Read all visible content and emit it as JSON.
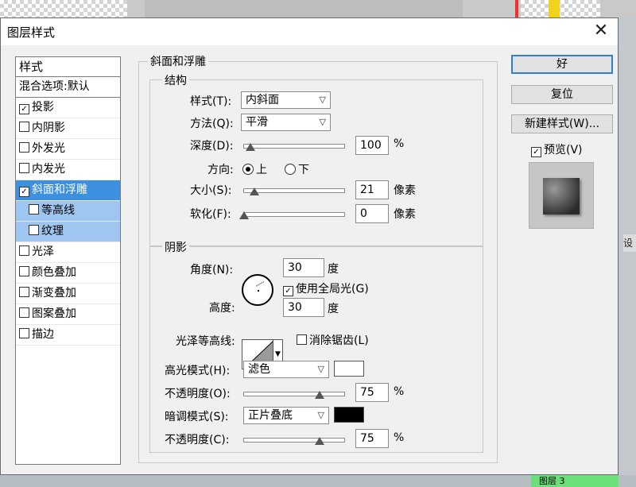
{
  "window": {
    "title": "图层样式",
    "close_glyph": "✕"
  },
  "style_list": {
    "header": "样式",
    "blend": "混合选项:默认",
    "items": [
      {
        "label": "投影",
        "checked": true
      },
      {
        "label": "内阴影",
        "checked": false
      },
      {
        "label": "外发光",
        "checked": false
      },
      {
        "label": "内发光",
        "checked": false
      },
      {
        "label": "斜面和浮雕",
        "checked": true,
        "selected": true
      },
      {
        "label": "等高线",
        "checked": false,
        "sub": true
      },
      {
        "label": "纹理",
        "checked": false,
        "sub": true
      },
      {
        "label": "光泽",
        "checked": false
      },
      {
        "label": "颜色叠加",
        "checked": false
      },
      {
        "label": "渐变叠加",
        "checked": false
      },
      {
        "label": "图案叠加",
        "checked": false
      },
      {
        "label": "描边",
        "checked": false
      }
    ]
  },
  "buttons": {
    "ok": "好",
    "reset": "复位",
    "new_style": "新建样式(W)...",
    "preview": "预览(V)"
  },
  "bevel": {
    "section_title": "斜面和浮雕",
    "structure": {
      "title": "结构",
      "style_label": "样式(T):",
      "style_value": "内斜面",
      "technique_label": "方法(Q):",
      "technique_value": "平滑",
      "depth_label": "深度(D):",
      "depth_value": "100",
      "depth_unit": "%",
      "depth_slider": 0.06,
      "direction_label": "方向:",
      "direction_up": "上",
      "direction_down": "下",
      "size_label": "大小(S):",
      "size_value": "21",
      "size_unit": "像素",
      "size_slider": 0.1,
      "soften_label": "软化(F):",
      "soften_value": "0",
      "soften_unit": "像素",
      "soften_slider": 0.0
    },
    "shading": {
      "title": "阴影",
      "angle_label": "角度(N):",
      "angle_value": "30",
      "angle_unit": "度",
      "global_light": "使用全局光(G)",
      "altitude_label": "高度:",
      "altitude_value": "30",
      "altitude_unit": "度",
      "gloss_label": "光泽等高线:",
      "anti_alias": "消除锯齿(L)",
      "highlight_mode_label": "高光模式(H):",
      "highlight_mode_value": "滤色",
      "highlight_color": "#ffffff",
      "highlight_opacity_label": "不透明度(O):",
      "highlight_opacity_value": "75",
      "highlight_opacity_unit": "%",
      "highlight_slider": 0.75,
      "shadow_mode_label": "暗调模式(S):",
      "shadow_mode_value": "正片叠底",
      "shadow_color": "#000000",
      "shadow_opacity_label": "不透明度(C):",
      "shadow_opacity_value": "75",
      "shadow_opacity_unit": "%",
      "shadow_slider": 0.75
    }
  },
  "background": {
    "right_tab": "设",
    "bottom_tab": "图层 3"
  }
}
